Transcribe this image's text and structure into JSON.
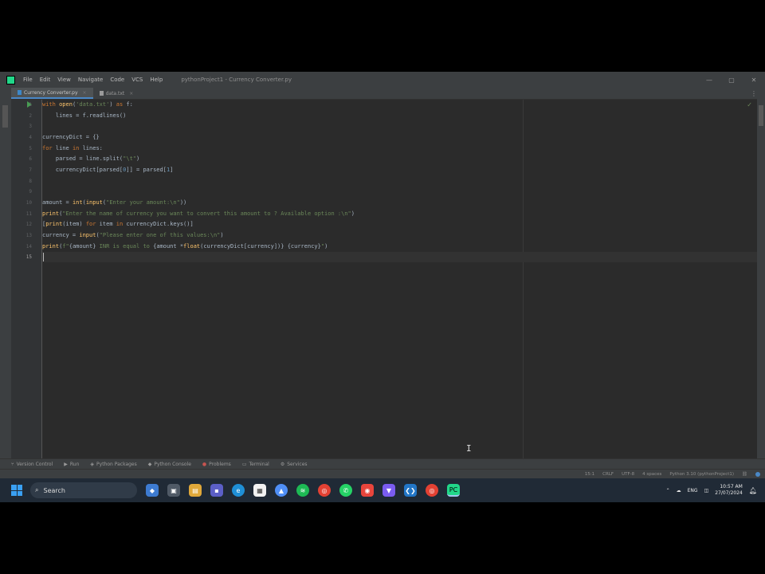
{
  "window": {
    "menu": [
      "File",
      "Edit",
      "View",
      "Navigate",
      "Code",
      "VCS",
      "Help"
    ],
    "title": "pythonProject1 - Currency Converter.py",
    "controls": [
      "—",
      "▢",
      "✕"
    ]
  },
  "tabs": [
    {
      "label": "Currency Converter.py",
      "active": true
    },
    {
      "label": "data.txt",
      "active": false
    }
  ],
  "editor": {
    "line_numbers": [
      "1",
      "2",
      "3",
      "4",
      "5",
      "6",
      "7",
      "8",
      "9",
      "10",
      "11",
      "12",
      "13",
      "14",
      "15"
    ],
    "current_line": "15",
    "code": [
      "with open('data.txt') as f:",
      "    lines = f.readlines()",
      "",
      "currencyDict = {}",
      "for line in lines:",
      "    parsed = line.split(\"\\t\")",
      "    currencyDict[parsed[0]] = parsed[1]",
      "",
      "",
      "amount = int(input(\"Enter your amount:\\n\"))",
      "print(\"Enter the name of currency you want to convert this amount to ? Available option :\\n\")",
      "[print(item) for item in currencyDict.keys()]",
      "currency = input(\"Please enter one of this values:\\n\")",
      "print(f\"{amount} INR is equal to {amount *float(currencyDict[currency])} {currency}\")",
      ""
    ]
  },
  "tool_windows": [
    {
      "label": "Version Control",
      "icon": "branch-icon"
    },
    {
      "label": "Run",
      "icon": "run-icon"
    },
    {
      "label": "Python Packages",
      "icon": "package-icon"
    },
    {
      "label": "Python Console",
      "icon": "console-icon"
    },
    {
      "label": "Problems",
      "icon": "problems-icon"
    },
    {
      "label": "Terminal",
      "icon": "terminal-icon"
    },
    {
      "label": "Services",
      "icon": "services-icon"
    }
  ],
  "status_bar": {
    "position": "15:1",
    "line_sep": "CRLF",
    "encoding": "UTF-8",
    "indent": "4 spaces",
    "interpreter": "Python 3.10 (pythonProject1)"
  },
  "taskbar": {
    "search_label": "Search",
    "tray_lang": "ENG",
    "time": "10:57 AM",
    "date": "27/07/2024"
  },
  "colors": {
    "editor_bg": "#2b2b2b",
    "keyword": "#cc7832",
    "string": "#6a8759",
    "accent": "#4a88c7"
  }
}
